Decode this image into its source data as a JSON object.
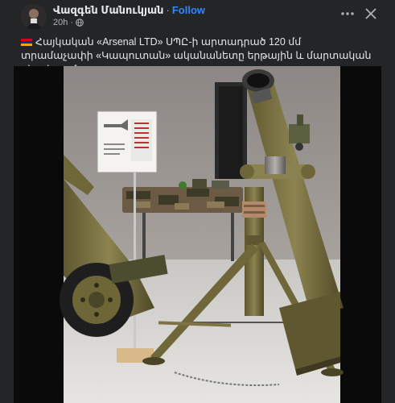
{
  "post": {
    "author_name": "Վազգեն Մանուկյան",
    "follow_label": "Follow",
    "time": "20h",
    "audience_icon": "globe-icon",
    "more_icon": "more-options-icon",
    "close_icon": "close-icon",
    "caption": "Հայկական «Arsenal LTD» ՍՊԸ-ի արտադրած 120 մմ տրամաչափի «Կապուտան» ականանետը երթային և մարտական դիրքերում:",
    "flag": "armenia-flag",
    "media_subject": "120mm mortar on display stand"
  },
  "colors": {
    "background": "#242526",
    "text": "#e4e6eb",
    "secondary": "#b0b3b8",
    "link": "#2d88ff",
    "mortar_olive": "#7a7040"
  }
}
